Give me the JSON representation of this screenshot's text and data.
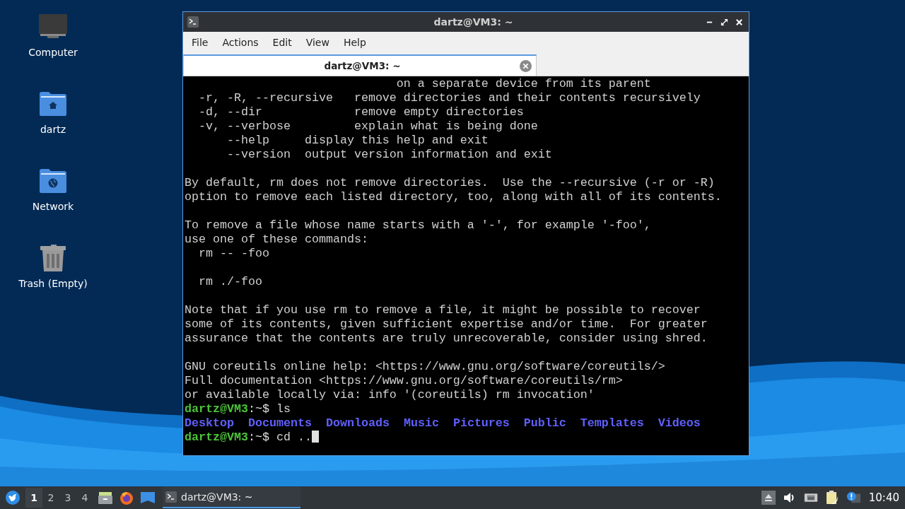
{
  "desktop_icons": [
    {
      "kind": "computer",
      "label": "Computer"
    },
    {
      "kind": "home",
      "label": "dartz"
    },
    {
      "kind": "network",
      "label": "Network"
    },
    {
      "kind": "trash",
      "label": "Trash (Empty)"
    }
  ],
  "window": {
    "title": "dartz@VM3: ~",
    "menu": [
      "File",
      "Actions",
      "Edit",
      "View",
      "Help"
    ],
    "tabs": [
      {
        "label": "dartz@VM3: ~",
        "selected": true
      }
    ],
    "terminal": {
      "lines": [
        {
          "kind": "text",
          "text": "                              on a separate device from its parent"
        },
        {
          "kind": "text",
          "text": "  -r, -R, --recursive   remove directories and their contents recursively"
        },
        {
          "kind": "text",
          "text": "  -d, --dir             remove empty directories"
        },
        {
          "kind": "text",
          "text": "  -v, --verbose         explain what is being done"
        },
        {
          "kind": "text",
          "text": "      --help     display this help and exit"
        },
        {
          "kind": "text",
          "text": "      --version  output version information and exit"
        },
        {
          "kind": "blank"
        },
        {
          "kind": "text",
          "text": "By default, rm does not remove directories.  Use the --recursive (-r or -R)"
        },
        {
          "kind": "text",
          "text": "option to remove each listed directory, too, along with all of its contents."
        },
        {
          "kind": "blank"
        },
        {
          "kind": "text",
          "text": "To remove a file whose name starts with a '-', for example '-foo',"
        },
        {
          "kind": "text",
          "text": "use one of these commands:"
        },
        {
          "kind": "text",
          "text": "  rm -- -foo"
        },
        {
          "kind": "blank"
        },
        {
          "kind": "text",
          "text": "  rm ./-foo"
        },
        {
          "kind": "blank"
        },
        {
          "kind": "text",
          "text": "Note that if you use rm to remove a file, it might be possible to recover"
        },
        {
          "kind": "text",
          "text": "some of its contents, given sufficient expertise and/or time.  For greater"
        },
        {
          "kind": "text",
          "text": "assurance that the contents are truly unrecoverable, consider using shred."
        },
        {
          "kind": "blank"
        },
        {
          "kind": "text",
          "text": "GNU coreutils online help: <https://www.gnu.org/software/coreutils/>"
        },
        {
          "kind": "text",
          "text": "Full documentation <https://www.gnu.org/software/coreutils/rm>"
        },
        {
          "kind": "text",
          "text": "or available locally via: info '(coreutils) rm invocation'"
        },
        {
          "kind": "prompt",
          "user": "dartz@VM3",
          "path": ":~$",
          "command": "ls"
        },
        {
          "kind": "listing",
          "items": [
            "Desktop",
            "Documents",
            "Downloads",
            "Music",
            "Pictures",
            "Public",
            "Templates",
            "Videos"
          ]
        },
        {
          "kind": "prompt",
          "user": "dartz@VM3",
          "path": ":~$",
          "command": "cd ..",
          "cursor": true
        }
      ]
    }
  },
  "taskbar": {
    "workspaces": [
      {
        "label": "1",
        "selected": true
      },
      {
        "label": "2",
        "selected": false
      },
      {
        "label": "3",
        "selected": false
      },
      {
        "label": "4",
        "selected": false
      }
    ],
    "launchers": [
      {
        "kind": "files"
      },
      {
        "kind": "browser"
      },
      {
        "kind": "desktop"
      }
    ],
    "tasks": [
      {
        "label": "dartz@VM3: ~",
        "selected": true
      }
    ],
    "tray": [
      {
        "kind": "eject"
      },
      {
        "kind": "volume"
      },
      {
        "kind": "network"
      },
      {
        "kind": "clipboard"
      },
      {
        "kind": "notification"
      }
    ],
    "clock": "10:40"
  }
}
